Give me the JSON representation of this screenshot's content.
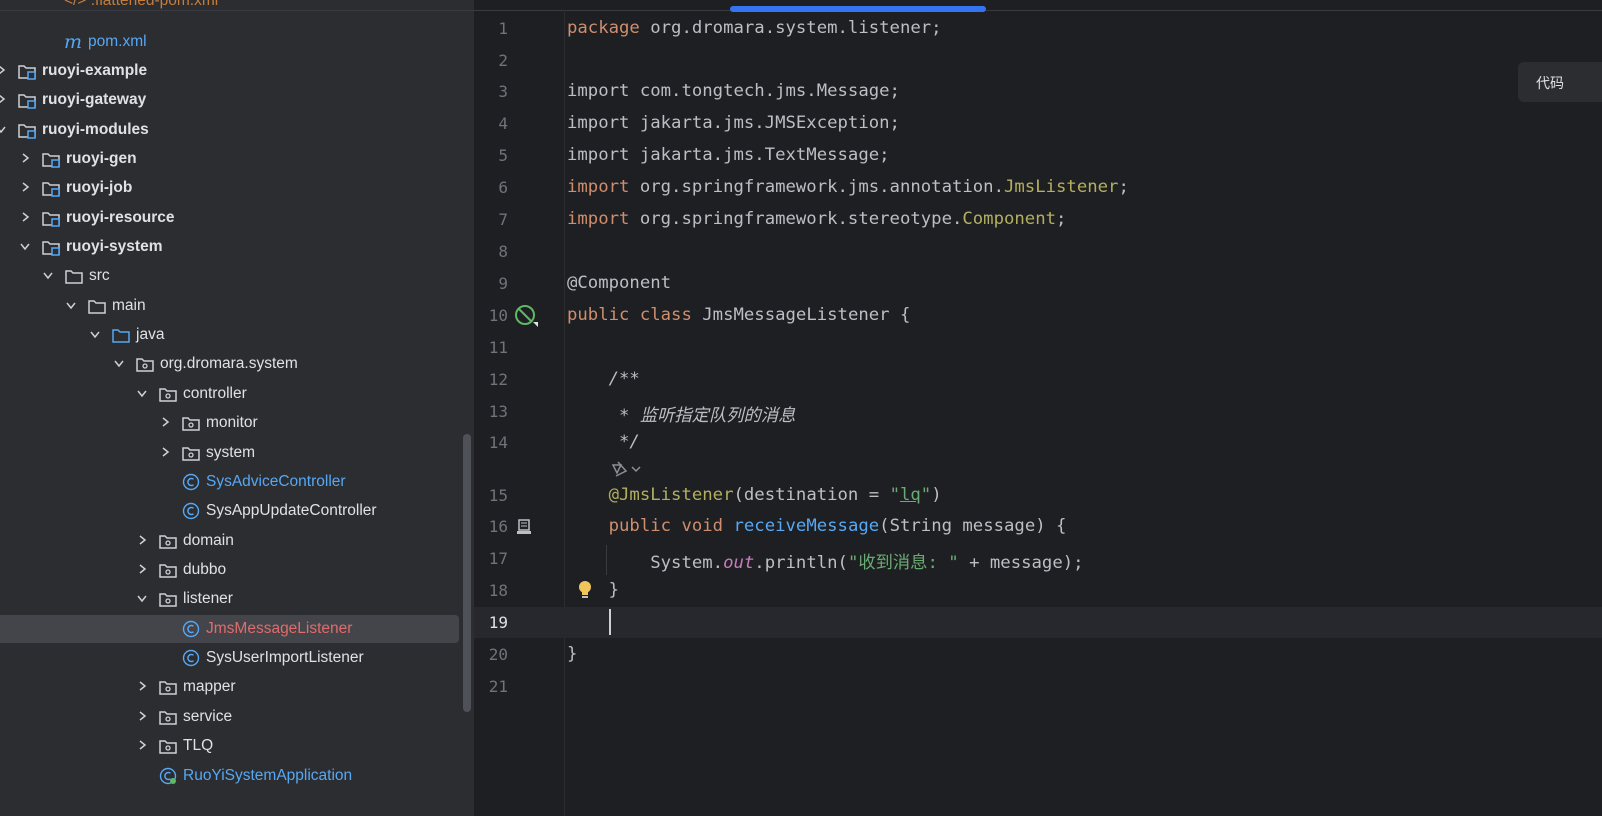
{
  "project_tree": {
    "items": [
      {
        "label": "</> .flattened-pom.xml",
        "icon": "xml-file-icon",
        "style": "orange"
      },
      {
        "label": "pom.xml",
        "icon": "maven-icon",
        "style": "blue"
      },
      {
        "label": "ruoyi-example",
        "icon": "module-folder-icon",
        "style": "bold"
      },
      {
        "label": "ruoyi-gateway",
        "icon": "module-folder-icon",
        "style": "bold"
      },
      {
        "label": "ruoyi-modules",
        "icon": "module-folder-icon",
        "style": "bold"
      },
      {
        "label": "ruoyi-gen",
        "icon": "module-folder-icon",
        "style": "bold"
      },
      {
        "label": "ruoyi-job",
        "icon": "module-folder-icon",
        "style": "bold"
      },
      {
        "label": "ruoyi-resource",
        "icon": "module-folder-icon",
        "style": "bold"
      },
      {
        "label": "ruoyi-system",
        "icon": "module-folder-icon",
        "style": "bold"
      },
      {
        "label": "src",
        "icon": "folder-icon",
        "style": ""
      },
      {
        "label": "main",
        "icon": "folder-icon",
        "style": ""
      },
      {
        "label": "java",
        "icon": "source-folder-icon",
        "style": ""
      },
      {
        "label": "org.dromara.system",
        "icon": "package-icon",
        "style": ""
      },
      {
        "label": "controller",
        "icon": "package-icon",
        "style": ""
      },
      {
        "label": "monitor",
        "icon": "package-icon",
        "style": ""
      },
      {
        "label": "system",
        "icon": "package-icon",
        "style": ""
      },
      {
        "label": "SysAdviceController",
        "icon": "class-icon",
        "style": "blue"
      },
      {
        "label": "SysAppUpdateController",
        "icon": "class-icon",
        "style": ""
      },
      {
        "label": "domain",
        "icon": "package-icon",
        "style": ""
      },
      {
        "label": "dubbo",
        "icon": "package-icon",
        "style": ""
      },
      {
        "label": "listener",
        "icon": "package-icon",
        "style": ""
      },
      {
        "label": "JmsMessageListener",
        "icon": "class-icon",
        "style": "red"
      },
      {
        "label": "SysUserImportListener",
        "icon": "class-icon",
        "style": ""
      },
      {
        "label": "mapper",
        "icon": "package-icon",
        "style": ""
      },
      {
        "label": "service",
        "icon": "package-icon",
        "style": ""
      },
      {
        "label": "TLQ",
        "icon": "package-icon",
        "style": ""
      },
      {
        "label": "RuoYiSystemApplication",
        "icon": "spring-class-icon",
        "style": "blue"
      }
    ]
  },
  "editor": {
    "line_numbers": [
      "1",
      "2",
      "3",
      "4",
      "5",
      "6",
      "7",
      "8",
      "9",
      "10",
      "11",
      "12",
      "13",
      "14",
      "15",
      "16",
      "17",
      "18",
      "19",
      "20",
      "21"
    ],
    "current_line": "19",
    "code": {
      "l1_kw": "package",
      "l1_rest": " org.dromara.system.listener;",
      "l3": "import com.tongtech.jms.Message;",
      "l4": "import jakarta.jms.JMSException;",
      "l5": "import jakarta.jms.TextMessage;",
      "l6_kw": "import",
      "l6_mid": " org.springframework.jms.annotation.",
      "l6_cls": "JmsListener",
      "l6_end": ";",
      "l7_kw": "import",
      "l7_mid": " org.springframework.stereotype.",
      "l7_cls": "Component",
      "l7_end": ";",
      "l9": "@Component",
      "l10_kw1": "public",
      "l10_kw2": "class",
      "l10_rest": " JmsMessageListener {",
      "l12": "    /**",
      "l13": "     * 监听指定队列的消息",
      "l14": "     */",
      "l15_ann": "@JmsListener",
      "l15_a": "(destination = ",
      "l15_q1": "\"",
      "l15_str": "lq",
      "l15_q2": "\"",
      "l15_end": ")",
      "l16_kw1": "public",
      "l16_kw2": "void",
      "l16_fn": "receiveMessage",
      "l16_rest": "(String message) {",
      "l17_a": "        System.",
      "l17_out": "out",
      "l17_b": ".println(",
      "l17_str": "\"收到消息: \"",
      "l17_c": " + message);",
      "l18": "    }",
      "l20": "}"
    }
  },
  "hint_button": {
    "label": "代码"
  },
  "colors": {
    "accent": "#3574f0",
    "keyword": "#cf8e6d",
    "annotation": "#b3ae60",
    "string": "#6aab73",
    "function": "#56a8f5",
    "comment": "#5f826b"
  }
}
